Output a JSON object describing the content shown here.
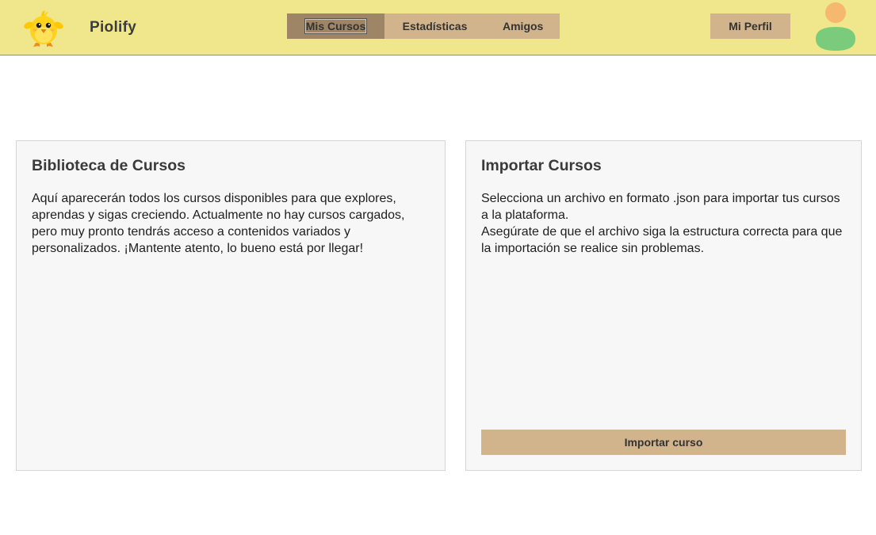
{
  "header": {
    "app_name": "Piolify",
    "logo_icon": "chick-mascot-icon",
    "nav_tabs": [
      {
        "label": "Mis Cursos",
        "active": true
      },
      {
        "label": "Estadísticas",
        "active": false
      },
      {
        "label": "Amigos",
        "active": false
      }
    ],
    "profile_label": "Mi Perfil",
    "avatar_icon": "user-avatar-icon"
  },
  "library": {
    "title": "Biblioteca de Cursos",
    "text": "Aquí aparecerán todos los cursos disponibles para que explores, aprendas y sigas creciendo. Actualmente no hay cursos cargados, pero muy pronto tendrás acceso a contenidos variados y personalizados. ¡Mantente atento, lo bueno está por llegar!"
  },
  "import": {
    "title": "Importar Cursos",
    "text_line1": "Selecciona un archivo en formato .json para importar tus cursos a la plataforma.",
    "text_line2": "Asegúrate de que el archivo siga la estructura correcta para que la importación se realice sin problemas.",
    "button_label": "Importar curso"
  },
  "colors": {
    "header_bg": "#f0e68c",
    "button_bg": "#d2b48c",
    "active_tab_bg": "#9e8566",
    "panel_bg": "#f7f7f7"
  }
}
